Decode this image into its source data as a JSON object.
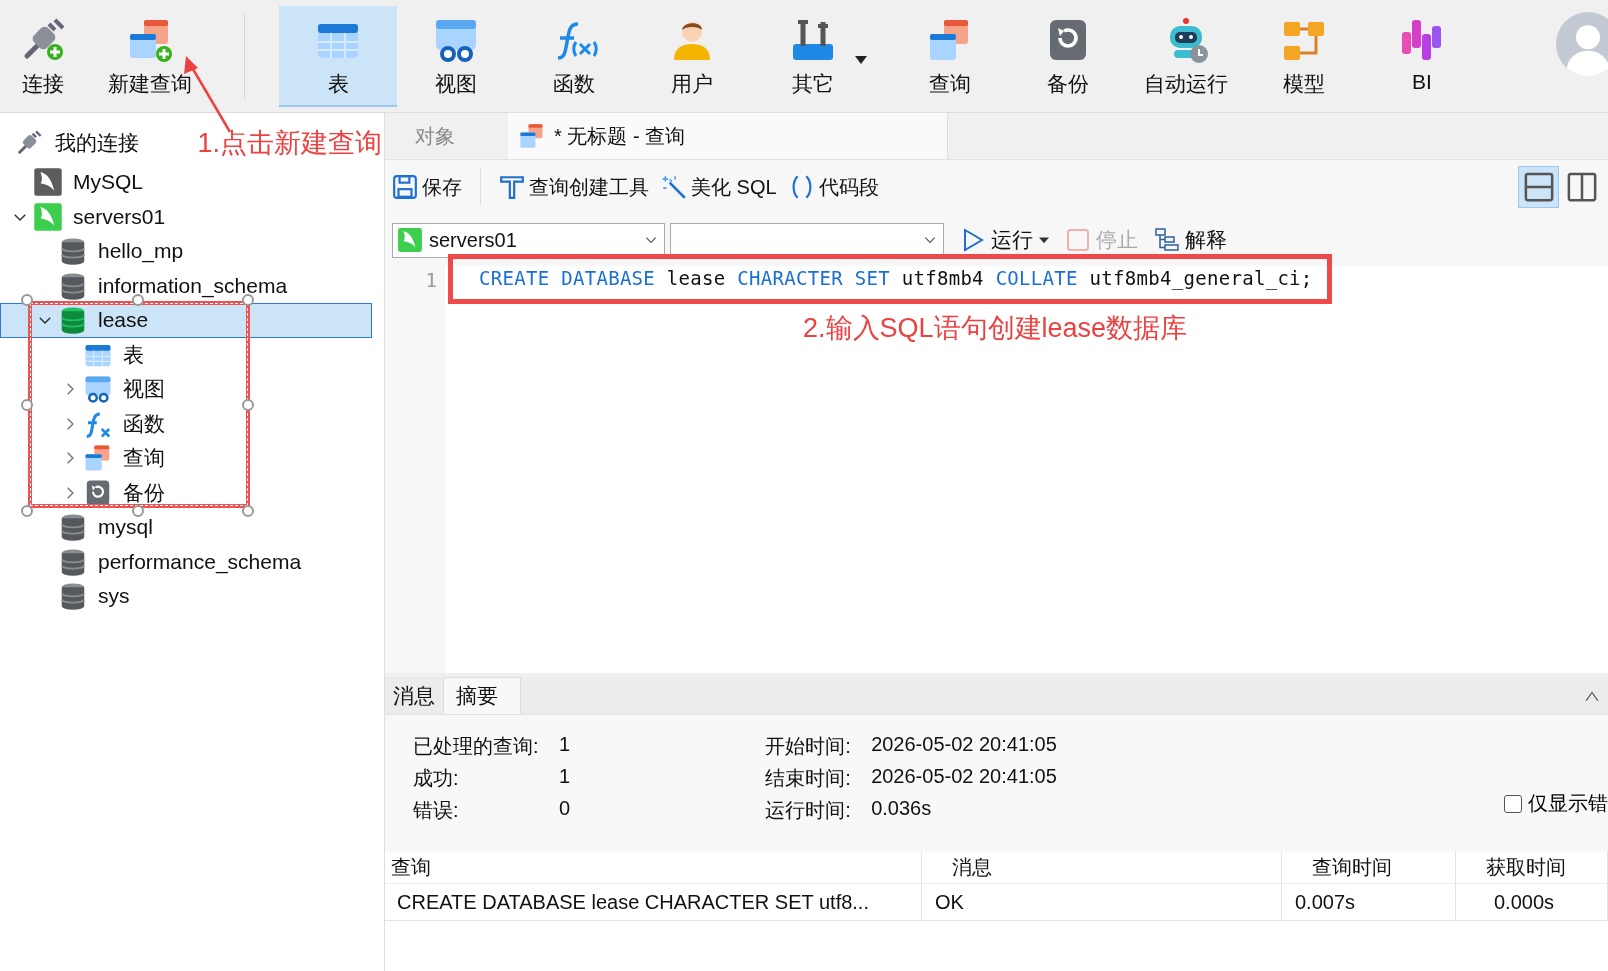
{
  "toolbar": {
    "items": [
      {
        "label": "连接",
        "selected": false,
        "dropdown": false
      },
      {
        "label": "新建查询",
        "selected": false,
        "dropdown": false
      },
      {
        "label": "表",
        "selected": true,
        "dropdown": false
      },
      {
        "label": "视图",
        "selected": false,
        "dropdown": false
      },
      {
        "label": "函数",
        "selected": false,
        "dropdown": false
      },
      {
        "label": "用户",
        "selected": false,
        "dropdown": false
      },
      {
        "label": "其它",
        "selected": false,
        "dropdown": true
      },
      {
        "label": "查询",
        "selected": false,
        "dropdown": false
      },
      {
        "label": "备份",
        "selected": false,
        "dropdown": false
      },
      {
        "label": "自动运行",
        "selected": false,
        "dropdown": false
      },
      {
        "label": "模型",
        "selected": false,
        "dropdown": false
      },
      {
        "label": "BI",
        "selected": false,
        "dropdown": false
      }
    ]
  },
  "sidebar": {
    "title": "我的连接",
    "note": "1.点击新建查询",
    "note_arrow": true,
    "selection_frame": true,
    "tree": [
      {
        "label": "MySQL",
        "kind": "connection",
        "selected": false,
        "expanded": false,
        "expander": false
      },
      {
        "label": "servers01",
        "kind": "connection",
        "selected": false,
        "expanded": true,
        "expander": true,
        "children": [
          {
            "label": "hello_mp",
            "kind": "database",
            "selected": false,
            "expanded": false,
            "expander": false
          },
          {
            "label": "information_schema",
            "kind": "database",
            "selected": false,
            "expanded": false,
            "expander": false
          },
          {
            "label": "lease",
            "kind": "database",
            "selected": true,
            "expanded": true,
            "expander": true,
            "children": [
              {
                "label": "表",
                "kind": "table",
                "selected": false,
                "expanded": false,
                "expander": false
              },
              {
                "label": "视图",
                "kind": "view",
                "selected": false,
                "expanded": false,
                "expander": true
              },
              {
                "label": "函数",
                "kind": "function",
                "selected": false,
                "expanded": false,
                "expander": true
              },
              {
                "label": "查询",
                "kind": "query",
                "selected": false,
                "expanded": false,
                "expander": true
              },
              {
                "label": "备份",
                "kind": "backup",
                "selected": false,
                "expanded": false,
                "expander": true
              }
            ]
          },
          {
            "label": "mysql",
            "kind": "database",
            "selected": false,
            "expanded": false,
            "expander": false
          },
          {
            "label": "performance_schema",
            "kind": "database",
            "selected": false,
            "expanded": false,
            "expander": false
          },
          {
            "label": "sys",
            "kind": "database",
            "selected": false,
            "expanded": false,
            "expander": false
          }
        ]
      }
    ]
  },
  "tabs": [
    {
      "label": "对象",
      "selected": false,
      "icon": false
    },
    {
      "label": "* 无标题 - 查询",
      "selected": true,
      "icon": true
    }
  ],
  "query_toolbar": {
    "buttons": [
      {
        "label": "保存",
        "kind": "save"
      },
      {
        "label": "查询创建工具",
        "kind": "builder"
      },
      {
        "label": "美化 SQL",
        "kind": "beautify"
      },
      {
        "label": "代码段",
        "kind": "snippet"
      }
    ],
    "layout_buttons": [
      {
        "selected": true
      },
      {
        "selected": false
      }
    ]
  },
  "run_bar": {
    "connection": "servers01",
    "actions": [
      {
        "label": "运行",
        "kind": "run",
        "disabled": false
      },
      {
        "label": "停止",
        "kind": "stop",
        "disabled": true
      },
      {
        "label": "解释",
        "kind": "explain",
        "disabled": false
      }
    ]
  },
  "editor": {
    "lines": [
      {
        "number": "1",
        "framed": true,
        "tokens": [
          {
            "text": "CREATE",
            "kind": "keyword"
          },
          {
            "text": "DATABASE",
            "kind": "keyword"
          },
          {
            "text": "lease",
            "kind": "plain"
          },
          {
            "text": "CHARACTER",
            "kind": "keyword"
          },
          {
            "text": "SET",
            "kind": "keyword"
          },
          {
            "text": "utf8mb4",
            "kind": "plain"
          },
          {
            "text": "COLLATE",
            "kind": "keyword"
          },
          {
            "text": "utf8mb4_general_ci;",
            "kind": "plain"
          }
        ]
      }
    ],
    "note": "2.输入SQL语句创建lease数据库"
  },
  "result_tabs": [
    {
      "label": "消息",
      "selected": false
    },
    {
      "label": "摘要",
      "selected": true
    }
  ],
  "summary": {
    "left": [
      {
        "label": "已处理的查询:",
        "value": "1"
      },
      {
        "label": "成功:",
        "value": "1"
      },
      {
        "label": "错误:",
        "value": "0"
      }
    ],
    "right": [
      {
        "label": "开始时间:",
        "value": "2026-05-02 20:41:05"
      },
      {
        "label": "结束时间:",
        "value": "2026-05-02 20:41:05"
      },
      {
        "label": "运行时间:",
        "value": "0.036s"
      }
    ],
    "errors_only": {
      "label": "仅显示错",
      "checked": false
    }
  },
  "results": {
    "columns": [
      "查询",
      "消息",
      "查询时间",
      "获取时间"
    ],
    "rows": [
      [
        "CREATE DATABASE lease CHARACTER SET utf8...",
        "OK",
        "0.007s",
        "0.000s"
      ]
    ]
  }
}
